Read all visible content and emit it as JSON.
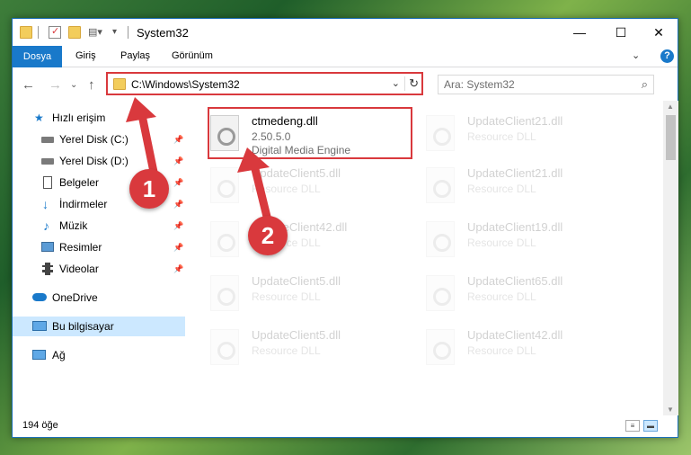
{
  "window": {
    "title": "System32",
    "controls": {
      "minimize": "—",
      "maximize": "☐",
      "close": "✕"
    }
  },
  "ribbon": {
    "tabs": [
      "Dosya",
      "Giriş",
      "Paylaş",
      "Görünüm"
    ],
    "help": "?"
  },
  "address": {
    "path": "C:\\Windows\\System32",
    "search_placeholder": "Ara: System32"
  },
  "sidebar": {
    "items": [
      {
        "label": "Hızlı erişim",
        "icon": "star-icon"
      },
      {
        "label": "Yerel Disk (C:)",
        "icon": "drive-icon"
      },
      {
        "label": "Yerel Disk (D:)",
        "icon": "drive-icon"
      },
      {
        "label": "Belgeler",
        "icon": "documents-icon"
      },
      {
        "label": "İndirmeler",
        "icon": "download-icon"
      },
      {
        "label": "Müzik",
        "icon": "music-icon"
      },
      {
        "label": "Resimler",
        "icon": "pictures-icon"
      },
      {
        "label": "Videolar",
        "icon": "videos-icon"
      },
      {
        "label": "OneDrive",
        "icon": "cloud-icon"
      },
      {
        "label": "Bu bilgisayar",
        "icon": "computer-icon"
      },
      {
        "label": "Ağ",
        "icon": "network-icon"
      }
    ]
  },
  "files": {
    "highlighted": {
      "name": "ctmedeng.dll",
      "version": "2.50.5.0",
      "description": "Digital Media Engine"
    },
    "left_column": [
      {
        "name": "UpdateClient5.dll",
        "type": "Resource DLL"
      },
      {
        "name": "UpdateClient42.dll",
        "type": "Resource DLL"
      },
      {
        "name": "UpdateClient5.dll",
        "type": "Resource DLL"
      },
      {
        "name": "UpdateClient5.dll",
        "type": "Resource DLL"
      }
    ],
    "right_column": [
      {
        "name": "UpdateClient21.dll",
        "type": "Resource DLL"
      },
      {
        "name": "UpdateClient21.dll",
        "type": "Resource DLL"
      },
      {
        "name": "UpdateClient19.dll",
        "type": "Resource DLL"
      },
      {
        "name": "UpdateClient65.dll",
        "type": "Resource DLL"
      },
      {
        "name": "UpdateClient42.dll",
        "type": "Resource DLL"
      }
    ]
  },
  "status": {
    "count": "194 öğe"
  },
  "callouts": [
    "1",
    "2"
  ],
  "colors": {
    "accent": "#1979ca",
    "highlight": "#d9393d",
    "selected_bg": "#cce8ff"
  }
}
